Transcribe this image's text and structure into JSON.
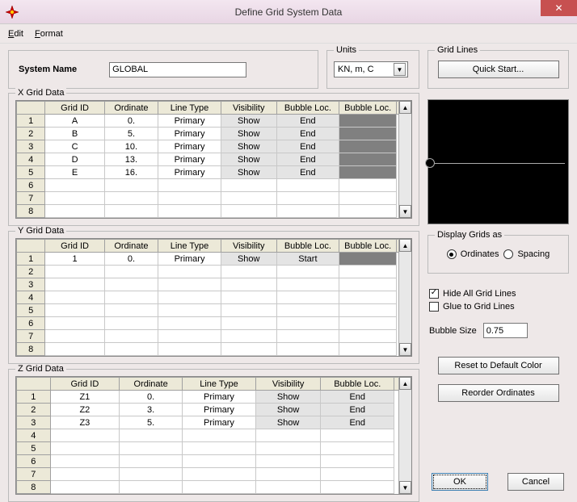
{
  "window": {
    "title": "Define Grid System Data",
    "menu": {
      "edit": "Edit",
      "format": "Format"
    }
  },
  "system_name": {
    "label": "System Name",
    "value": "GLOBAL"
  },
  "units": {
    "legend": "Units",
    "value": "KN, m, C"
  },
  "gridlines": {
    "legend": "Grid Lines",
    "quick_start": "Quick Start..."
  },
  "x_grid": {
    "legend": "X Grid Data",
    "headers": [
      "Grid ID",
      "Ordinate",
      "Line Type",
      "Visibility",
      "Bubble Loc.",
      "Bubble Loc."
    ],
    "rows": [
      {
        "n": "1",
        "id": "A",
        "ord": "0.",
        "lt": "Primary",
        "vis": "Show",
        "bl": "End"
      },
      {
        "n": "2",
        "id": "B",
        "ord": "5.",
        "lt": "Primary",
        "vis": "Show",
        "bl": "End"
      },
      {
        "n": "3",
        "id": "C",
        "ord": "10.",
        "lt": "Primary",
        "vis": "Show",
        "bl": "End"
      },
      {
        "n": "4",
        "id": "D",
        "ord": "13.",
        "lt": "Primary",
        "vis": "Show",
        "bl": "End"
      },
      {
        "n": "5",
        "id": "E",
        "ord": "16.",
        "lt": "Primary",
        "vis": "Show",
        "bl": "End"
      },
      {
        "n": "6",
        "id": "",
        "ord": "",
        "lt": "",
        "vis": "",
        "bl": ""
      },
      {
        "n": "7",
        "id": "",
        "ord": "",
        "lt": "",
        "vis": "",
        "bl": ""
      },
      {
        "n": "8",
        "id": "",
        "ord": "",
        "lt": "",
        "vis": "",
        "bl": ""
      }
    ]
  },
  "y_grid": {
    "legend": "Y Grid Data",
    "headers": [
      "Grid ID",
      "Ordinate",
      "Line Type",
      "Visibility",
      "Bubble Loc.",
      "Bubble Loc."
    ],
    "rows": [
      {
        "n": "1",
        "id": "1",
        "ord": "0.",
        "lt": "Primary",
        "vis": "Show",
        "bl": "Start"
      },
      {
        "n": "2",
        "id": "",
        "ord": "",
        "lt": "",
        "vis": "",
        "bl": ""
      },
      {
        "n": "3",
        "id": "",
        "ord": "",
        "lt": "",
        "vis": "",
        "bl": ""
      },
      {
        "n": "4",
        "id": "",
        "ord": "",
        "lt": "",
        "vis": "",
        "bl": ""
      },
      {
        "n": "5",
        "id": "",
        "ord": "",
        "lt": "",
        "vis": "",
        "bl": ""
      },
      {
        "n": "6",
        "id": "",
        "ord": "",
        "lt": "",
        "vis": "",
        "bl": ""
      },
      {
        "n": "7",
        "id": "",
        "ord": "",
        "lt": "",
        "vis": "",
        "bl": ""
      },
      {
        "n": "8",
        "id": "",
        "ord": "",
        "lt": "",
        "vis": "",
        "bl": ""
      }
    ]
  },
  "z_grid": {
    "legend": "Z Grid Data",
    "headers": [
      "Grid ID",
      "Ordinate",
      "Line Type",
      "Visibility",
      "Bubble Loc."
    ],
    "rows": [
      {
        "n": "1",
        "id": "Z1",
        "ord": "0.",
        "lt": "Primary",
        "vis": "Show",
        "bl": "End"
      },
      {
        "n": "2",
        "id": "Z2",
        "ord": "3.",
        "lt": "Primary",
        "vis": "Show",
        "bl": "End"
      },
      {
        "n": "3",
        "id": "Z3",
        "ord": "5.",
        "lt": "Primary",
        "vis": "Show",
        "bl": "End"
      },
      {
        "n": "4",
        "id": "",
        "ord": "",
        "lt": "",
        "vis": "",
        "bl": ""
      },
      {
        "n": "5",
        "id": "",
        "ord": "",
        "lt": "",
        "vis": "",
        "bl": ""
      },
      {
        "n": "6",
        "id": "",
        "ord": "",
        "lt": "",
        "vis": "",
        "bl": ""
      },
      {
        "n": "7",
        "id": "",
        "ord": "",
        "lt": "",
        "vis": "",
        "bl": ""
      },
      {
        "n": "8",
        "id": "",
        "ord": "",
        "lt": "",
        "vis": "",
        "bl": ""
      }
    ]
  },
  "display_as": {
    "legend": "Display Grids as",
    "ordinates": "Ordinates",
    "spacing": "Spacing",
    "selected": "ordinates"
  },
  "options": {
    "hide_all": "Hide All Grid Lines",
    "glue_to": "Glue to Grid Lines",
    "hide_checked": true,
    "glue_checked": false,
    "bubble_size_label": "Bubble Size",
    "bubble_size_value": "0.75"
  },
  "buttons": {
    "reset": "Reset to Default Color",
    "reorder": "Reorder Ordinates",
    "ok": "OK",
    "cancel": "Cancel"
  }
}
